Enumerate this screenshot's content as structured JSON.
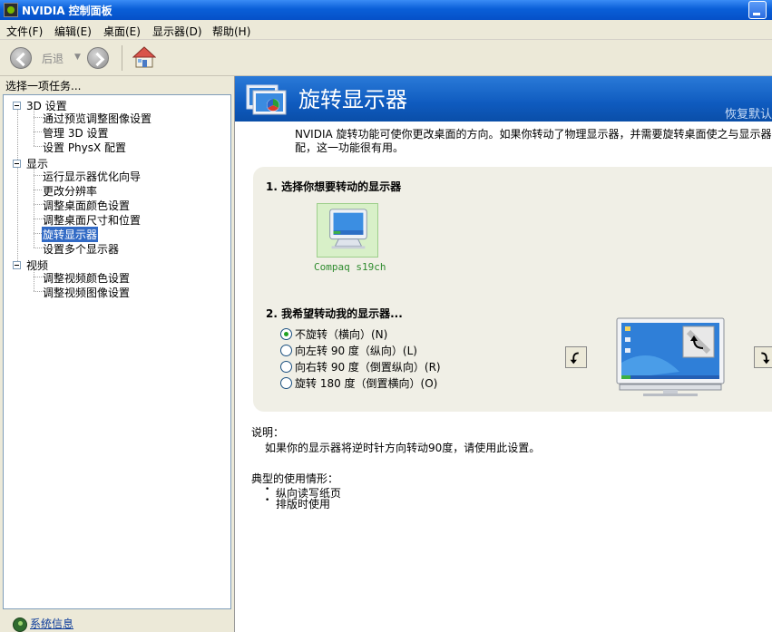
{
  "window": {
    "title": "NVIDIA 控制面板"
  },
  "menu": [
    "文件(F)",
    "编辑(E)",
    "桌面(E)",
    "显示器(D)",
    "帮助(H)"
  ],
  "toolbar": {
    "back_label": "后退"
  },
  "task_pane": {
    "label": "选择一项任务...",
    "tree": [
      {
        "category": "3D 设置",
        "items": [
          "通过预览调整图像设置",
          "管理 3D 设置",
          "设置 PhysX 配置"
        ]
      },
      {
        "category": "显示",
        "items": [
          "运行显示器优化向导",
          "更改分辨率",
          "调整桌面颜色设置",
          "调整桌面尺寸和位置",
          "旋转显示器",
          "设置多个显示器"
        ]
      },
      {
        "category": "视频",
        "items": [
          "调整视频颜色设置",
          "调整视频图像设置"
        ]
      }
    ],
    "selected_item": "旋转显示器",
    "system_info": "系统信息"
  },
  "content": {
    "title": "旋转显示器",
    "restore_defaults": "恢复默认",
    "intro": "NVIDIA 旋转功能可使你更改桌面的方向。如果你转动了物理显示器，并需要旋转桌面使之与显示器的配，这一功能很有用。",
    "step1": "1. 选择你想要转动的显示器",
    "monitor_name": "Compaq s19ch",
    "step2": "2. 我希望转动我的显示器...",
    "options": [
      {
        "label": "不旋转（横向）(N)",
        "checked": true
      },
      {
        "label": "向左转 90 度（纵向）(L)",
        "checked": false
      },
      {
        "label": "向右转 90 度（倒置纵向）(R)",
        "checked": false
      },
      {
        "label": "旋转 180 度（倒置横向）(O)",
        "checked": false
      }
    ],
    "description_label": "说明：",
    "description": "如果你的显示器将逆时针方向转动90度，请使用此设置。",
    "usage_label": "典型的使用情形：",
    "usage": [
      "纵向读写纸页",
      "排版时使用"
    ]
  },
  "colors": {
    "banner": "#1060c4",
    "selection": "#316ac5",
    "title_bar": "#0a5fd8",
    "monitor_label": "#2e8b2e"
  }
}
